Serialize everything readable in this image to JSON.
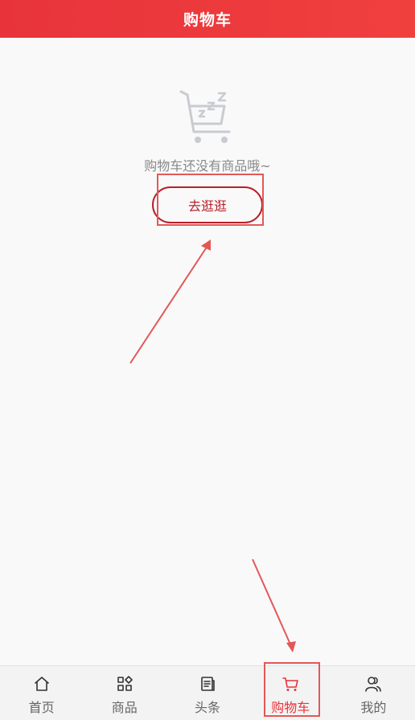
{
  "header": {
    "title": "购物车"
  },
  "empty_state": {
    "icon": "empty-cart-sleeping-icon",
    "message": "购物车还没有商品哦~",
    "button_label": "去逛逛"
  },
  "tabbar": {
    "items": [
      {
        "label": "首页",
        "icon": "home-icon",
        "active": false
      },
      {
        "label": "商品",
        "icon": "category-grid-icon",
        "active": false
      },
      {
        "label": "头条",
        "icon": "news-icon",
        "active": false
      },
      {
        "label": "购物车",
        "icon": "cart-icon",
        "active": true
      },
      {
        "label": "我的",
        "icon": "user-icon",
        "active": false
      }
    ]
  },
  "colors": {
    "brand_red": "#e8333b",
    "button_red": "#b8202a",
    "annotation_red": "#e45757"
  }
}
